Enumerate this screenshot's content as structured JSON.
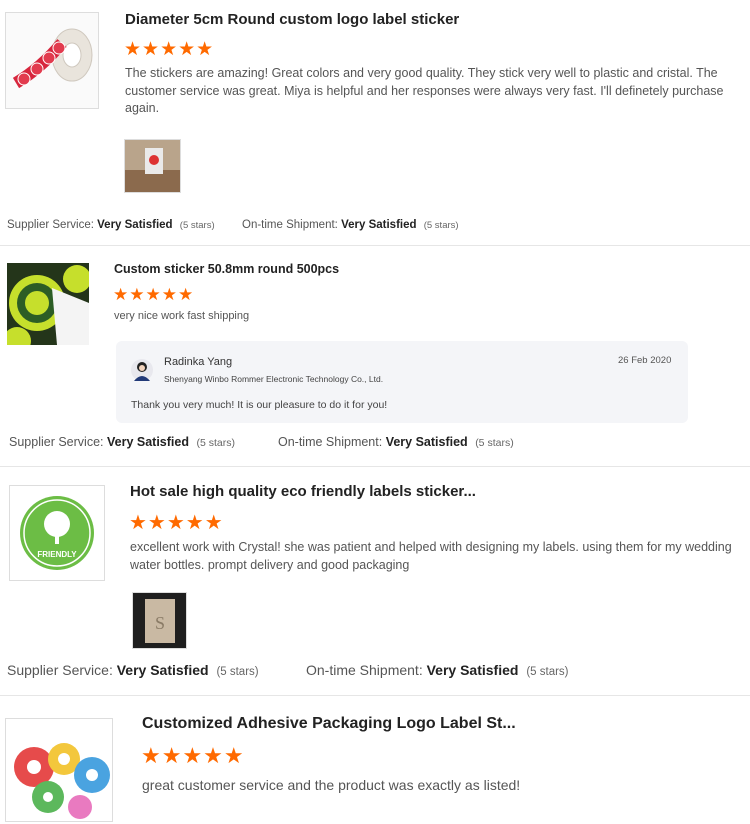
{
  "reviews": [
    {
      "title": "Diameter 5cm Round custom logo label sticker",
      "stars": "★★★★★",
      "rating": 5,
      "text": "The stickers are amazing! Great colors and very good quality. They stick very well to plastic and cristal. The customer service was great. Miya is helpful and her responses were always very fast. I'll definetely purchase again.",
      "supplier_label": "Supplier Service:",
      "supplier_value": "Very Satisfied",
      "supplier_stars": "(5 stars)",
      "shipment_label": "On-time Shipment:",
      "shipment_value": "Very Satisfied",
      "shipment_stars": "(5 stars)"
    },
    {
      "title": "Custom sticker 50.8mm round 500pcs",
      "stars": "★★★★★",
      "rating": 5,
      "text": "very nice work fast shipping",
      "reply": {
        "name": "Radinka Yang",
        "company": "Shenyang Winbo Rommer Electronic Technology Co., Ltd.",
        "date": "26 Feb 2020",
        "text": "Thank you very much! It is our pleasure to do it for you!"
      },
      "supplier_label": "Supplier Service:",
      "supplier_value": "Very Satisfied",
      "supplier_stars": "(5 stars)",
      "shipment_label": "On-time Shipment:",
      "shipment_value": "Very Satisfied",
      "shipment_stars": "(5 stars)"
    },
    {
      "title": "Hot sale high quality eco friendly labels sticker...",
      "stars": "★★★★★",
      "rating": 5,
      "thumb_text": "FRIENDLY",
      "text": "excellent work with Crystal! she was patient and helped with designing my labels. using them for my wedding water bottles. prompt delivery and good packaging",
      "supplier_label": "Supplier Service:",
      "supplier_value": "Very Satisfied",
      "supplier_stars": "(5 stars)",
      "shipment_label": "On-time Shipment:",
      "shipment_value": "Very Satisfied",
      "shipment_stars": "(5 stars)"
    },
    {
      "title": "Customized Adhesive Packaging Logo Label St...",
      "stars": "★★★★★",
      "rating": 5,
      "text": "great customer service and the product was exactly as listed!"
    }
  ],
  "colors": {
    "star": "#ff6a00",
    "eco_green": "#6cbd45",
    "reply_bg": "#f4f5f8"
  }
}
